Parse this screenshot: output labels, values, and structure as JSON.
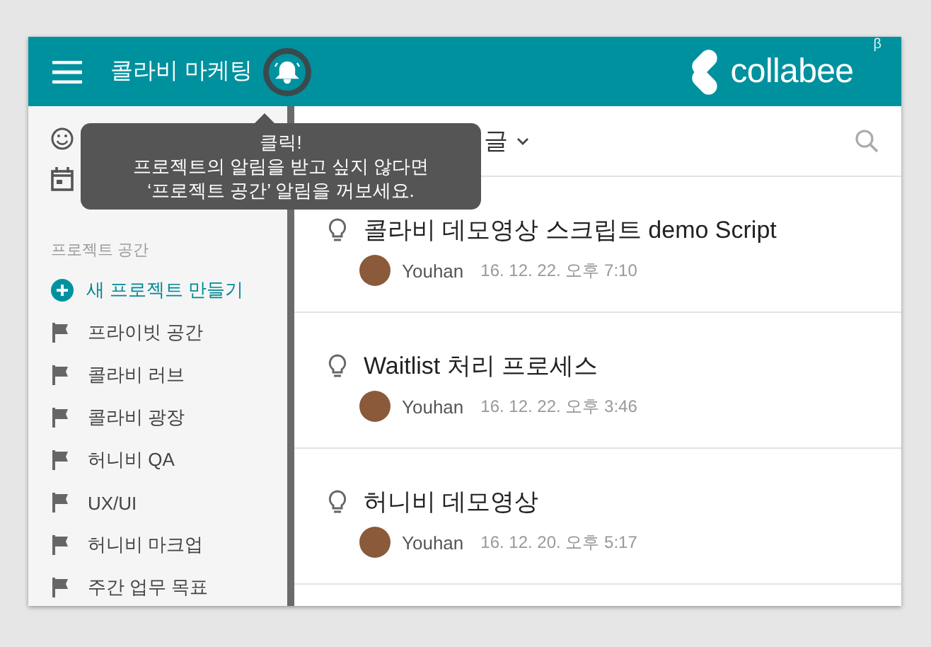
{
  "header": {
    "title": "콜라비 마케팅",
    "logo": "collabee",
    "logo_mark": "β"
  },
  "tooltip": {
    "lines": [
      "클릭!",
      "프로젝트의 알림을 받고 싶지 않다면",
      "‘프로젝트 공간’ 알림을 꺼보세요."
    ]
  },
  "sidebar": {
    "section_label": "프로젝트 공간",
    "new_project": "새 프로젝트 만들기",
    "projects": [
      "프라이빗 공간",
      "콜라비 러브",
      "콜라비 광장",
      "허니비 QA",
      "UX/UI",
      "허니비 마크업",
      "주간 업무 목표"
    ]
  },
  "feed": {
    "filter": "글",
    "posts": [
      {
        "title": "콜라비 데모영상 스크립트 demo Script",
        "author": "Youhan",
        "time": "16. 12. 22. 오후 7:10"
      },
      {
        "title": "Waitlist 처리 프로세스",
        "author": "Youhan",
        "time": "16. 12. 22. 오후 3:46"
      },
      {
        "title": "허니비 데모영상",
        "author": "Youhan",
        "time": "16. 12. 20. 오후 5:17"
      }
    ]
  }
}
